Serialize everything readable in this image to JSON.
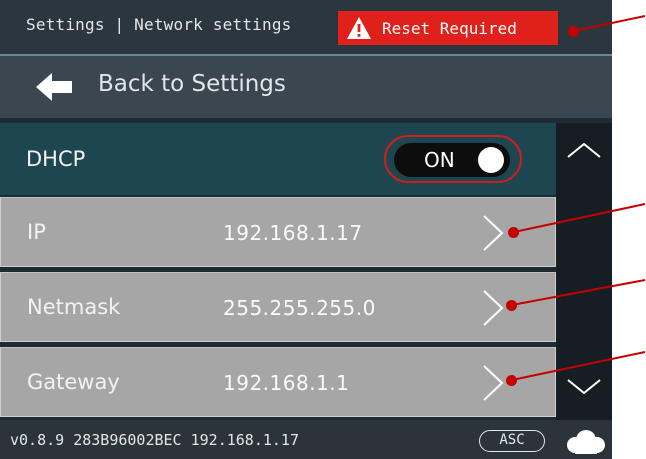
{
  "header": {
    "breadcrumb": "Settings | Network settings",
    "reset_badge": "Reset Required",
    "reset_icon": "warning-triangle-icon"
  },
  "back": {
    "label": "Back to Settings",
    "icon": "back-arrow-icon"
  },
  "dhcp": {
    "label": "DHCP",
    "toggle_label": "ON",
    "enabled": true
  },
  "settings": [
    {
      "label": "IP",
      "value": "192.168.1.17"
    },
    {
      "label": "Netmask",
      "value": "255.255.255.0"
    },
    {
      "label": "Gateway",
      "value": "192.168.1.1"
    }
  ],
  "statusbar": {
    "text": "v0.8.9 283B96002BEC 192.168.1.17",
    "asc_label": "ASC",
    "cloud_icon": "cloud-icon"
  },
  "colors": {
    "reset_badge": "#e0201b",
    "dhcp_row": "#1e4651",
    "setting_row": "#a6a6a6",
    "callout": "#c40000"
  }
}
